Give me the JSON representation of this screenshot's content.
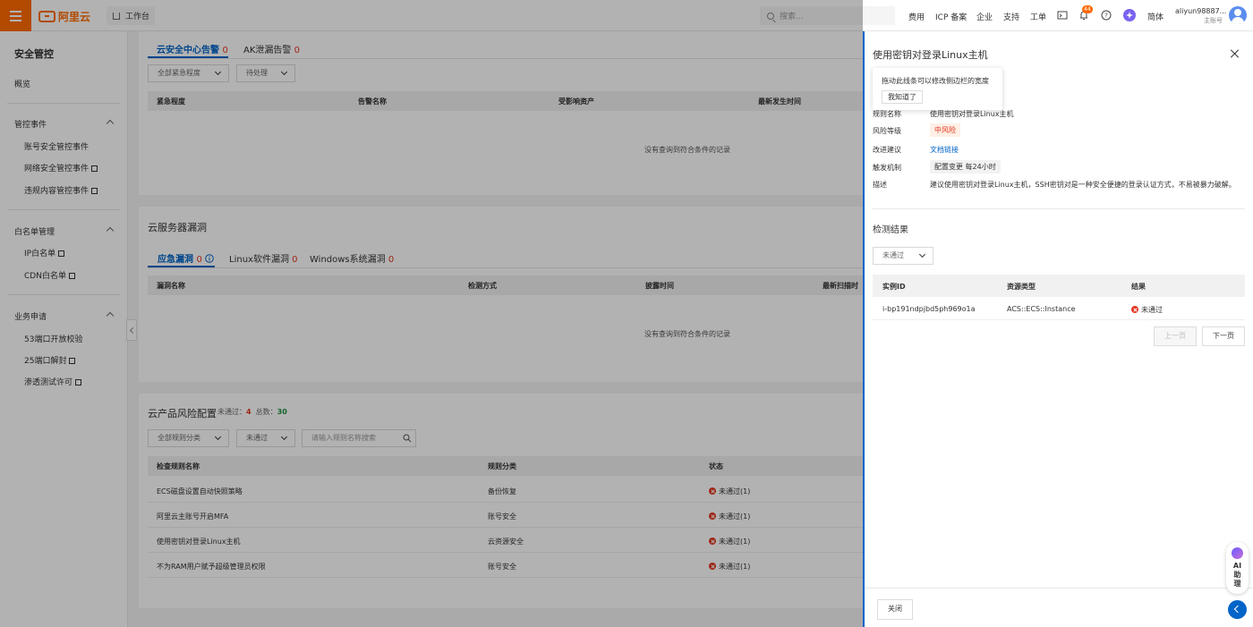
{
  "topbar": {
    "brand": "阿里云",
    "workbench": "工作台",
    "search_placeholder": "搜索...",
    "links": [
      "费用",
      "ICP 备案",
      "企业",
      "支持",
      "工单"
    ],
    "notification_count": "44",
    "lang": "简体",
    "user_name": "aliyun98887...",
    "user_role": "主账号"
  },
  "sidebar": {
    "title": "安全管控",
    "overview": "概览",
    "group1": "管控事件",
    "group1_items": [
      "账号安全管控事件",
      "网络安全管控事件",
      "违规内容管控事件"
    ],
    "group2": "白名单管理",
    "group2_items": [
      "IP白名单",
      "CDN白名单"
    ],
    "group3": "业务申请",
    "group3_items": [
      "53端口开放校验",
      "25端口解封",
      "渗透测试许可"
    ]
  },
  "alerts": {
    "tab1": "云安全中心告警",
    "tab1_count": "0",
    "tab2": "AK泄漏告警",
    "tab2_count": "0",
    "filter1": "全部紧急程度",
    "filter2": "待处理",
    "cols": [
      "紧急程度",
      "告警名称",
      "受影响资产",
      "最新发生时间"
    ],
    "empty": "没有查询到符合条件的记录"
  },
  "vulns": {
    "title": "云服务器漏洞",
    "tab1": "应急漏洞",
    "tab1_count": "0",
    "tab2": "Linux软件漏洞",
    "tab2_count": "0",
    "tab3": "Windows系统漏洞",
    "tab3_count": "0",
    "cols": [
      "漏洞名称",
      "检测方式",
      "披露时间",
      "最新扫描时"
    ],
    "empty": "没有查询到符合条件的记录"
  },
  "risk": {
    "title": "云产品风险配置",
    "failed_label": "未通过：",
    "failed_count": "4",
    "total_label": "总数：",
    "total_count": "30",
    "filter1": "全部规则分类",
    "filter2": "未通过",
    "search_placeholder": "请输入规则名称搜索",
    "cols": [
      "检查规则名称",
      "规则分类",
      "状态"
    ],
    "rows": [
      {
        "name": "ECS磁盘设置自动快照策略",
        "category": "备份恢复",
        "status": "未通过(1)"
      },
      {
        "name": "阿里云主账号开启MFA",
        "category": "账号安全",
        "status": "未通过(1)"
      },
      {
        "name": "使用密钥对登录Linux主机",
        "category": "云资源安全",
        "status": "未通过(1)"
      },
      {
        "name": "不为RAM用户赋予超级管理员权限",
        "category": "账号安全",
        "status": "未通过(1)"
      }
    ]
  },
  "drawer": {
    "title": "使用密钥对登录Linux主机",
    "tooltip_text": "拖动此线条可以修改侧边栏的宽度",
    "tooltip_button": "我知道了",
    "rule_name_label": "规则名称",
    "rule_name": "使用密钥对登录Linux主机",
    "risk_level_label": "风险等级",
    "risk_level": "中风险",
    "suggestion_label": "改进建议",
    "suggestion_link": "文档链接",
    "trigger_label": "触发机制",
    "trigger_value": "配置变更 每24小时",
    "desc_label": "描述",
    "desc_value": "建议使用密钥对登录Linux主机，SSH密钥对是一种安全便捷的登录认证方式，不易被暴力破解。",
    "result_title": "检测结果",
    "result_filter": "未通过",
    "cols": [
      "实例ID",
      "资源类型",
      "结果"
    ],
    "row": {
      "id": "i-bp191ndpjbd5ph969o1a",
      "type": "ACS::ECS::Instance",
      "result": "未通过"
    },
    "prev": "上一页",
    "next": "下一页",
    "close": "关闭"
  },
  "ai": {
    "label1": "AI",
    "label2": "助",
    "label3": "理"
  },
  "colors": {
    "brand": "#ff6a00",
    "accent": "#0064c8",
    "danger": "#e3341e"
  }
}
